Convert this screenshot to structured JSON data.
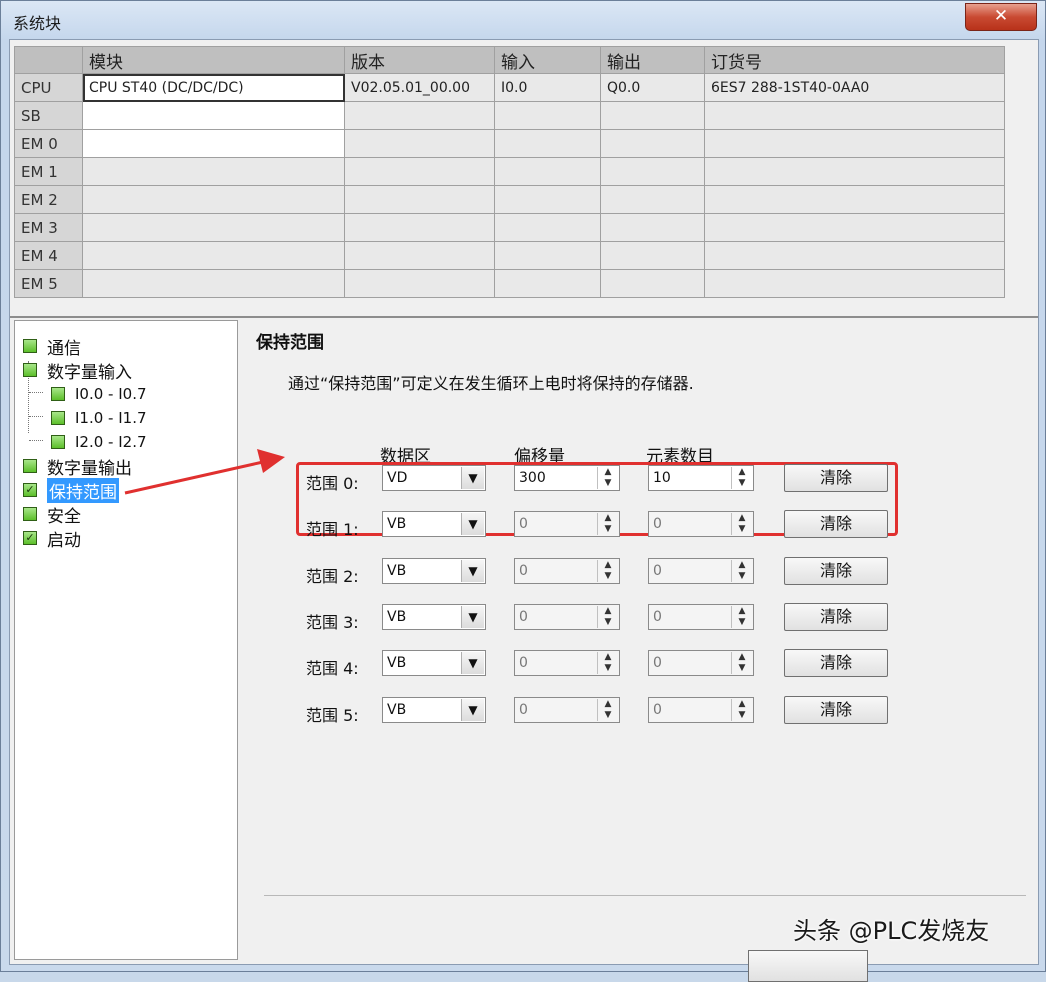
{
  "window": {
    "title": "系统块",
    "close_glyph": "✕"
  },
  "grid": {
    "headers": [
      "模块",
      "版本",
      "输入",
      "输出",
      "订货号"
    ],
    "rows": [
      {
        "label": "CPU",
        "module": "CPU ST40 (DC/DC/DC)",
        "version": "V02.05.01_00.00",
        "input": "I0.0",
        "output": "Q0.0",
        "order": "6ES7 288-1ST40-0AA0"
      },
      {
        "label": "SB",
        "module": "",
        "version": "",
        "input": "",
        "output": "",
        "order": ""
      },
      {
        "label": "EM 0",
        "module": "",
        "version": "",
        "input": "",
        "output": "",
        "order": ""
      },
      {
        "label": "EM 1",
        "module": "",
        "version": "",
        "input": "",
        "output": "",
        "order": ""
      },
      {
        "label": "EM 2",
        "module": "",
        "version": "",
        "input": "",
        "output": "",
        "order": ""
      },
      {
        "label": "EM 3",
        "module": "",
        "version": "",
        "input": "",
        "output": "",
        "order": ""
      },
      {
        "label": "EM 4",
        "module": "",
        "version": "",
        "input": "",
        "output": "",
        "order": ""
      },
      {
        "label": "EM 5",
        "module": "",
        "version": "",
        "input": "",
        "output": "",
        "order": ""
      }
    ]
  },
  "tree": {
    "items": [
      {
        "label": "通信",
        "icon": "green-square-icon"
      },
      {
        "label": "数字量输入",
        "icon": "green-square-icon"
      },
      {
        "label": "I0.0 - I0.7",
        "icon": "green-square-icon"
      },
      {
        "label": "I1.0 - I1.7",
        "icon": "green-square-icon"
      },
      {
        "label": "I2.0 - I2.7",
        "icon": "green-square-icon"
      },
      {
        "label": "数字量输出",
        "icon": "green-square-icon"
      },
      {
        "label": "保持范围",
        "icon": "green-check-icon",
        "selected": true
      },
      {
        "label": "安全",
        "icon": "green-square-icon"
      },
      {
        "label": "启动",
        "icon": "green-check-icon"
      }
    ]
  },
  "panel": {
    "title": "保持范围",
    "description": "通过“保持范围”可定义在发生循环上电时将保持的存储器.",
    "col_data_area": "数据区",
    "col_offset": "偏移量",
    "col_count": "元素数目",
    "clear_label": "清除",
    "ranges": [
      {
        "label": "范围 0:",
        "area": "VD",
        "offset": "300",
        "count": "10"
      },
      {
        "label": "范围 1:",
        "area": "VB",
        "offset": "0",
        "count": "0"
      },
      {
        "label": "范围 2:",
        "area": "VB",
        "offset": "0",
        "count": "0"
      },
      {
        "label": "范围 3:",
        "area": "VB",
        "offset": "0",
        "count": "0"
      },
      {
        "label": "范围 4:",
        "area": "VB",
        "offset": "0",
        "count": "0"
      },
      {
        "label": "范围 5:",
        "area": "VB",
        "offset": "0",
        "count": "0"
      }
    ],
    "highlight_color": "#e0302f"
  },
  "watermark": "头条 @PLC发烧友"
}
